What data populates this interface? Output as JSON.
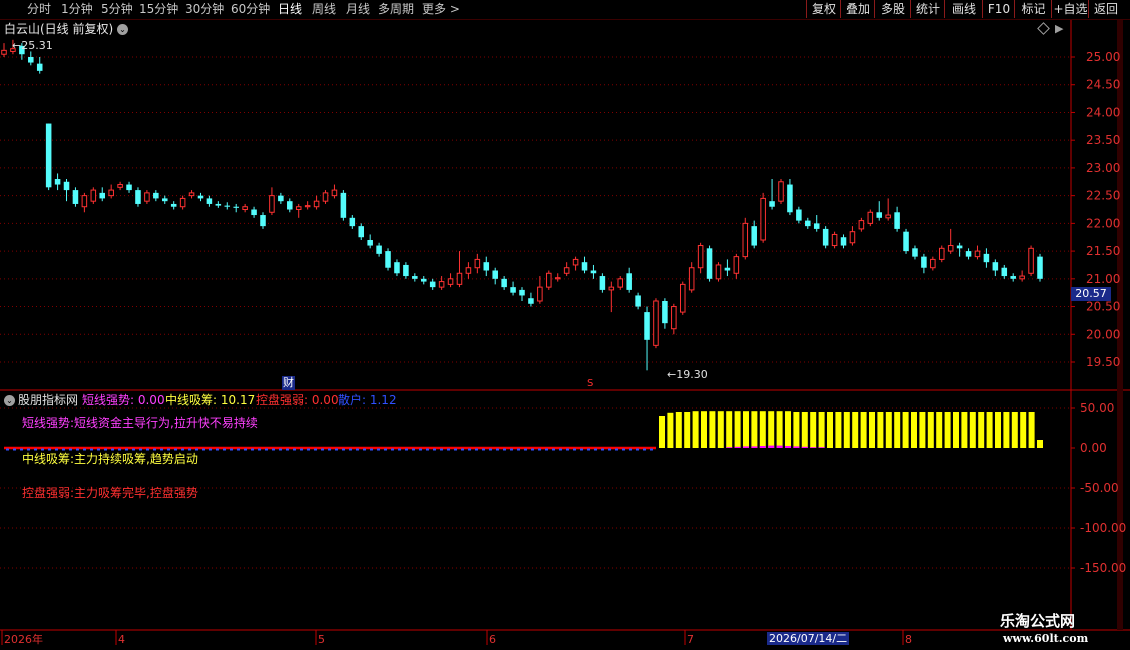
{
  "toolbar": {
    "periods": [
      "分时",
      "1分钟",
      "5分钟",
      "15分钟",
      "30分钟",
      "60分钟",
      "日线",
      "周线",
      "月线",
      "多周期",
      "更多 >"
    ],
    "active_period": "日线",
    "buttons": [
      "复权",
      "叠加",
      "多股",
      "统计",
      "画线",
      "F10",
      "标记",
      "+自选",
      "返回"
    ]
  },
  "stock": {
    "title": "白云山(日线 前复权)",
    "high_label": "25.31",
    "low_label": "19.30",
    "current_price": "20.57",
    "marker_cai": "财",
    "marker_s": "S"
  },
  "indicator": {
    "title": "股朋指标网",
    "values": [
      {
        "label": "短线强势: 0.00",
        "color": "#ff40ff"
      },
      {
        "label": "中线吸筹: 10.17",
        "color": "#ffff40"
      },
      {
        "label": "控盘强弱: 0.00",
        "color": "#ff3030"
      },
      {
        "label": "散户: 1.12",
        "color": "#3050ff"
      }
    ],
    "notes": [
      {
        "text": "短线强势:短线资金主导行为,拉升快不易持续",
        "color": "#ff40ff"
      },
      {
        "text": "中线吸筹:主力持续吸筹,趋势启动",
        "color": "#ffff40"
      },
      {
        "text": "控盘强弱:主力吸筹完毕,控盘强势",
        "color": "#ff3030"
      }
    ]
  },
  "time_axis": {
    "labels": [
      "2026年",
      "4",
      "5",
      "6",
      "7",
      "8"
    ],
    "selected_date": "2026/07/14/二"
  },
  "watermark": {
    "line1": "乐淘公式网",
    "line2": "www.60lt.com"
  },
  "colors": {
    "up": "#ff3232",
    "down": "#54fcfc",
    "grid": "#800000",
    "axis": "#c00000",
    "bar_yellow": "#ffff00",
    "bar_magenta": "#ff00ff",
    "base_red": "#ff0000",
    "dash_blue": "#3050ff"
  },
  "chart_data": [
    {
      "type": "candlestick",
      "title": "白云山(日线 前复权)",
      "y_ticks": [
        19.5,
        20.0,
        20.5,
        21.0,
        21.5,
        22.0,
        22.5,
        23.0,
        23.5,
        24.0,
        24.5,
        25.0
      ],
      "ylim": [
        19.1,
        25.35
      ],
      "candles": [
        [
          25.05,
          25.12,
          25.25,
          25.0
        ],
        [
          25.1,
          25.15,
          25.31,
          25.05
        ],
        [
          25.2,
          25.05,
          25.25,
          24.95
        ],
        [
          25.0,
          24.9,
          25.1,
          24.85
        ],
        [
          24.88,
          24.75,
          25.0,
          24.7
        ],
        [
          23.8,
          22.65,
          23.8,
          22.6
        ],
        [
          22.8,
          22.7,
          22.9,
          22.6
        ],
        [
          22.75,
          22.6,
          22.8,
          22.4
        ],
        [
          22.6,
          22.35,
          22.65,
          22.3
        ],
        [
          22.3,
          22.5,
          22.55,
          22.2
        ],
        [
          22.4,
          22.6,
          22.65,
          22.35
        ],
        [
          22.55,
          22.45,
          22.65,
          22.4
        ],
        [
          22.5,
          22.6,
          22.7,
          22.45
        ],
        [
          22.65,
          22.7,
          22.75,
          22.6
        ],
        [
          22.7,
          22.6,
          22.75,
          22.55
        ],
        [
          22.6,
          22.35,
          22.65,
          22.3
        ],
        [
          22.4,
          22.55,
          22.6,
          22.35
        ],
        [
          22.55,
          22.45,
          22.6,
          22.4
        ],
        [
          22.45,
          22.4,
          22.5,
          22.35
        ],
        [
          22.35,
          22.3,
          22.4,
          22.25
        ],
        [
          22.3,
          22.45,
          22.5,
          22.25
        ],
        [
          22.5,
          22.55,
          22.6,
          22.45
        ],
        [
          22.5,
          22.45,
          22.55,
          22.4
        ],
        [
          22.45,
          22.35,
          22.5,
          22.3
        ],
        [
          22.35,
          22.32,
          22.4,
          22.28
        ],
        [
          22.32,
          22.3,
          22.38,
          22.25
        ],
        [
          22.3,
          22.28,
          22.35,
          22.2
        ],
        [
          22.25,
          22.3,
          22.35,
          22.2
        ],
        [
          22.25,
          22.15,
          22.3,
          22.1
        ],
        [
          22.15,
          21.95,
          22.2,
          21.9
        ],
        [
          22.2,
          22.5,
          22.65,
          22.15
        ],
        [
          22.5,
          22.4,
          22.55,
          22.35
        ],
        [
          22.4,
          22.25,
          22.45,
          22.2
        ],
        [
          22.25,
          22.3,
          22.35,
          22.1
        ],
        [
          22.3,
          22.32,
          22.4,
          22.25
        ],
        [
          22.3,
          22.4,
          22.5,
          22.25
        ],
        [
          22.4,
          22.55,
          22.6,
          22.35
        ],
        [
          22.5,
          22.6,
          22.7,
          22.45
        ],
        [
          22.55,
          22.1,
          22.6,
          22.05
        ],
        [
          22.1,
          21.95,
          22.15,
          21.9
        ],
        [
          21.95,
          21.75,
          22.0,
          21.7
        ],
        [
          21.7,
          21.6,
          21.8,
          21.55
        ],
        [
          21.6,
          21.45,
          21.65,
          21.4
        ],
        [
          21.5,
          21.2,
          21.55,
          21.15
        ],
        [
          21.3,
          21.1,
          21.35,
          21.05
        ],
        [
          21.25,
          21.05,
          21.3,
          21.0
        ],
        [
          21.05,
          21.0,
          21.1,
          20.95
        ],
        [
          21.0,
          20.95,
          21.05,
          20.9
        ],
        [
          20.95,
          20.85,
          21.0,
          20.8
        ],
        [
          20.85,
          20.95,
          21.05,
          20.8
        ],
        [
          20.9,
          21.0,
          21.1,
          20.85
        ],
        [
          20.9,
          21.1,
          21.5,
          20.85
        ],
        [
          21.1,
          21.2,
          21.3,
          21.0
        ],
        [
          21.2,
          21.35,
          21.45,
          21.1
        ],
        [
          21.3,
          21.15,
          21.4,
          21.05
        ],
        [
          21.15,
          21.0,
          21.2,
          20.9
        ],
        [
          21.0,
          20.85,
          21.05,
          20.8
        ],
        [
          20.85,
          20.75,
          20.95,
          20.7
        ],
        [
          20.8,
          20.7,
          20.85,
          20.6
        ],
        [
          20.65,
          20.55,
          20.75,
          20.5
        ],
        [
          20.6,
          20.85,
          21.05,
          20.55
        ],
        [
          20.85,
          21.1,
          21.15,
          20.8
        ],
        [
          21.0,
          21.02,
          21.1,
          20.95
        ],
        [
          21.1,
          21.2,
          21.3,
          21.05
        ],
        [
          21.25,
          21.35,
          21.4,
          21.15
        ],
        [
          21.3,
          21.15,
          21.4,
          21.1
        ],
        [
          21.15,
          21.1,
          21.25,
          21.0
        ],
        [
          21.05,
          20.8,
          21.1,
          20.75
        ],
        [
          20.8,
          20.85,
          20.95,
          20.4
        ],
        [
          20.85,
          21.0,
          21.05,
          20.8
        ],
        [
          21.1,
          20.8,
          21.2,
          20.75
        ],
        [
          20.7,
          20.5,
          20.75,
          20.45
        ],
        [
          20.4,
          19.9,
          20.5,
          19.35
        ],
        [
          19.8,
          20.6,
          20.65,
          19.75
        ],
        [
          20.6,
          20.2,
          20.65,
          20.1
        ],
        [
          20.1,
          20.5,
          20.55,
          20.0
        ],
        [
          20.4,
          20.9,
          20.95,
          20.35
        ],
        [
          20.8,
          21.2,
          21.3,
          20.75
        ],
        [
          21.2,
          21.6,
          21.65,
          21.1
        ],
        [
          21.55,
          21.0,
          21.6,
          20.95
        ],
        [
          21.0,
          21.25,
          21.3,
          20.95
        ],
        [
          21.2,
          21.15,
          21.35,
          21.05
        ],
        [
          21.1,
          21.4,
          21.45,
          21.0
        ],
        [
          21.4,
          22.0,
          22.1,
          21.35
        ],
        [
          21.95,
          21.6,
          22.05,
          21.55
        ],
        [
          21.7,
          22.45,
          22.55,
          21.65
        ],
        [
          22.4,
          22.3,
          22.8,
          22.25
        ],
        [
          22.4,
          22.75,
          22.8,
          22.35
        ],
        [
          22.7,
          22.2,
          22.8,
          22.15
        ],
        [
          22.25,
          22.05,
          22.3,
          22.0
        ],
        [
          22.05,
          21.95,
          22.1,
          21.9
        ],
        [
          22.0,
          21.9,
          22.15,
          21.85
        ],
        [
          21.9,
          21.6,
          21.95,
          21.55
        ],
        [
          21.6,
          21.8,
          21.85,
          21.55
        ],
        [
          21.75,
          21.6,
          21.8,
          21.55
        ],
        [
          21.65,
          21.85,
          21.95,
          21.6
        ],
        [
          21.9,
          22.05,
          22.1,
          21.85
        ],
        [
          22.0,
          22.2,
          22.25,
          21.95
        ],
        [
          22.2,
          22.1,
          22.4,
          22.05
        ],
        [
          22.1,
          22.15,
          22.45,
          22.05
        ],
        [
          22.2,
          21.9,
          22.3,
          21.85
        ],
        [
          21.85,
          21.5,
          21.9,
          21.45
        ],
        [
          21.55,
          21.4,
          21.6,
          21.35
        ],
        [
          21.4,
          21.2,
          21.45,
          21.1
        ],
        [
          21.2,
          21.35,
          21.4,
          21.15
        ],
        [
          21.35,
          21.55,
          21.6,
          21.3
        ],
        [
          21.5,
          21.6,
          21.9,
          21.45
        ],
        [
          21.6,
          21.55,
          21.65,
          21.4
        ],
        [
          21.5,
          21.4,
          21.55,
          21.35
        ],
        [
          21.4,
          21.5,
          21.6,
          21.35
        ],
        [
          21.45,
          21.3,
          21.55,
          21.2
        ],
        [
          21.3,
          21.15,
          21.35,
          21.05
        ],
        [
          21.2,
          21.05,
          21.25,
          21.0
        ],
        [
          21.05,
          21.0,
          21.1,
          20.95
        ],
        [
          21.0,
          21.05,
          21.15,
          20.95
        ],
        [
          21.1,
          21.55,
          21.6,
          21.05
        ],
        [
          21.4,
          21.0,
          21.45,
          20.95
        ]
      ]
    },
    {
      "type": "bar",
      "title": "股朋指标网",
      "y_ticks": [
        -150.0,
        -100.0,
        -50.0,
        0.0,
        50.0
      ],
      "ylim": [
        -180,
        65
      ],
      "series": [
        {
          "name": "中线吸筹",
          "start_index": 78,
          "values": [
            40,
            43,
            44,
            44,
            45,
            45,
            45,
            45,
            45,
            46,
            46,
            46,
            46,
            46,
            46,
            46,
            46,
            46,
            46,
            46,
            46,
            46,
            46,
            46,
            46,
            46,
            46,
            46,
            46,
            46,
            46,
            46,
            46,
            46,
            46,
            46,
            45,
            45,
            45,
            45,
            45,
            45,
            45,
            45,
            45,
            45,
            45,
            45,
            45,
            45,
            45,
            45,
            45,
            45,
            45,
            45,
            45,
            45,
            45,
            45,
            45,
            45,
            45,
            45,
            45,
            45,
            45,
            45,
            45,
            45,
            45,
            45,
            45,
            45,
            45,
            45,
            45,
            45,
            45,
            45,
            45,
            45,
            45,
            45,
            45,
            45,
            45,
            45,
            45,
            45,
            45,
            45,
            45,
            45,
            45,
            45,
            45,
            45,
            45,
            45,
            45,
            45,
            45,
            45,
            10
          ]
        },
        {
          "name": "短线强势",
          "start_index": 100,
          "values": [
            1,
            1,
            2,
            2,
            3,
            3,
            3,
            3,
            2,
            2,
            2,
            1,
            1,
            1,
            0,
            0,
            0,
            0,
            0,
            0,
            0,
            0,
            0,
            0,
            0,
            0,
            0,
            0,
            0,
            0,
            0,
            0,
            0,
            0,
            0,
            0,
            0,
            0,
            0,
            0,
            0,
            0,
            0,
            0,
            0,
            0,
            0,
            0,
            0,
            0,
            0,
            0,
            0,
            0,
            0,
            0,
            0,
            0,
            0,
            0,
            0,
            0,
            0,
            0,
            0,
            0,
            0,
            0,
            0,
            0,
            0,
            0,
            0,
            0,
            0,
            0,
            0,
            0,
            0,
            0,
            0,
            0,
            0,
            0,
            0,
            0,
            0
          ]
        }
      ]
    }
  ]
}
